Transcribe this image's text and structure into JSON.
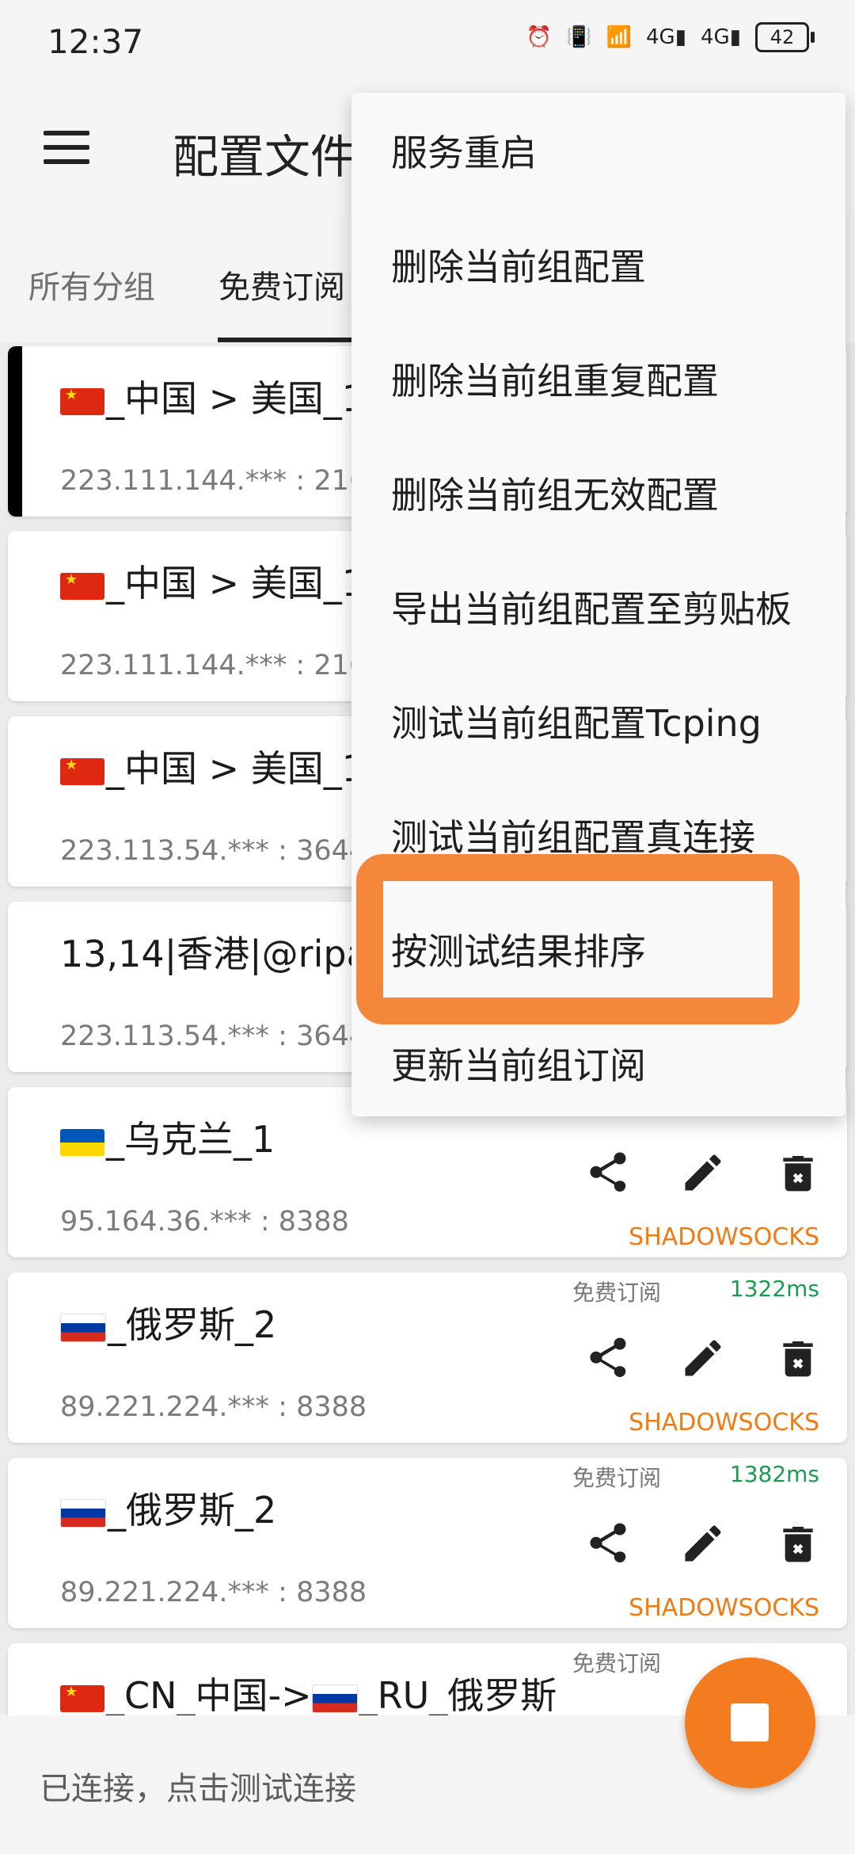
{
  "status_bar": {
    "time": "12:37",
    "battery": "42",
    "icons": [
      "key-icon",
      "nfc-icon",
      "alarm-icon",
      "vibrate-icon",
      "wifi-icon",
      "signal-4g-icon",
      "signal-4g-icon"
    ]
  },
  "app_bar": {
    "title": "配置文件"
  },
  "tabs": [
    {
      "label": "所有分组",
      "active": false
    },
    {
      "label": "免费订阅",
      "active": true
    }
  ],
  "list": [
    {
      "name": "_中国 > 美国_1",
      "flag": "cn",
      "address": "223.111.144.*** : 2167",
      "selected": true
    },
    {
      "name": "_中国 > 美国_1",
      "flag": "cn",
      "address": "223.111.144.*** : 2167"
    },
    {
      "name": "_中国 > 美国_1",
      "flag": "cn",
      "address": "223.113.54.*** : 36442"
    },
    {
      "name": "13,14|香港|@ripa",
      "flag": "",
      "address": "223.113.54.*** : 36442"
    },
    {
      "name": "_乌克兰_1",
      "flag": "ua",
      "address": "95.164.36.*** : 8388",
      "group": "",
      "latency": "",
      "type": "SHADOWSOCKS"
    },
    {
      "name": "_俄罗斯_2",
      "flag": "ru",
      "address": "89.221.224.*** : 8388",
      "group": "免费订阅",
      "latency": "1322ms",
      "type": "SHADOWSOCKS"
    },
    {
      "name": "_俄罗斯_2",
      "flag": "ru",
      "address": "89.221.224.*** : 8388",
      "group": "免费订阅",
      "latency": "1382ms",
      "type": "SHADOWSOCKS"
    },
    {
      "name": "_CN_中国->",
      "name_suffix": "_RU_俄罗斯",
      "flag": "cn",
      "address": "",
      "group": "免费订阅",
      "latency": "",
      "type": ""
    }
  ],
  "menu": {
    "items": [
      "服务重启",
      "删除当前组配置",
      "删除当前组重复配置",
      "删除当前组无效配置",
      "导出当前组配置至剪贴板",
      "测试当前组配置Tcping",
      "测试当前组配置真连接",
      "按测试结果排序",
      "更新当前组订阅"
    ]
  },
  "bottom": {
    "status_text": "已连接，点击测试连接"
  },
  "colors": {
    "accent": "#f47c20",
    "latency": "#1a9b50",
    "type": "#ef7b12"
  }
}
